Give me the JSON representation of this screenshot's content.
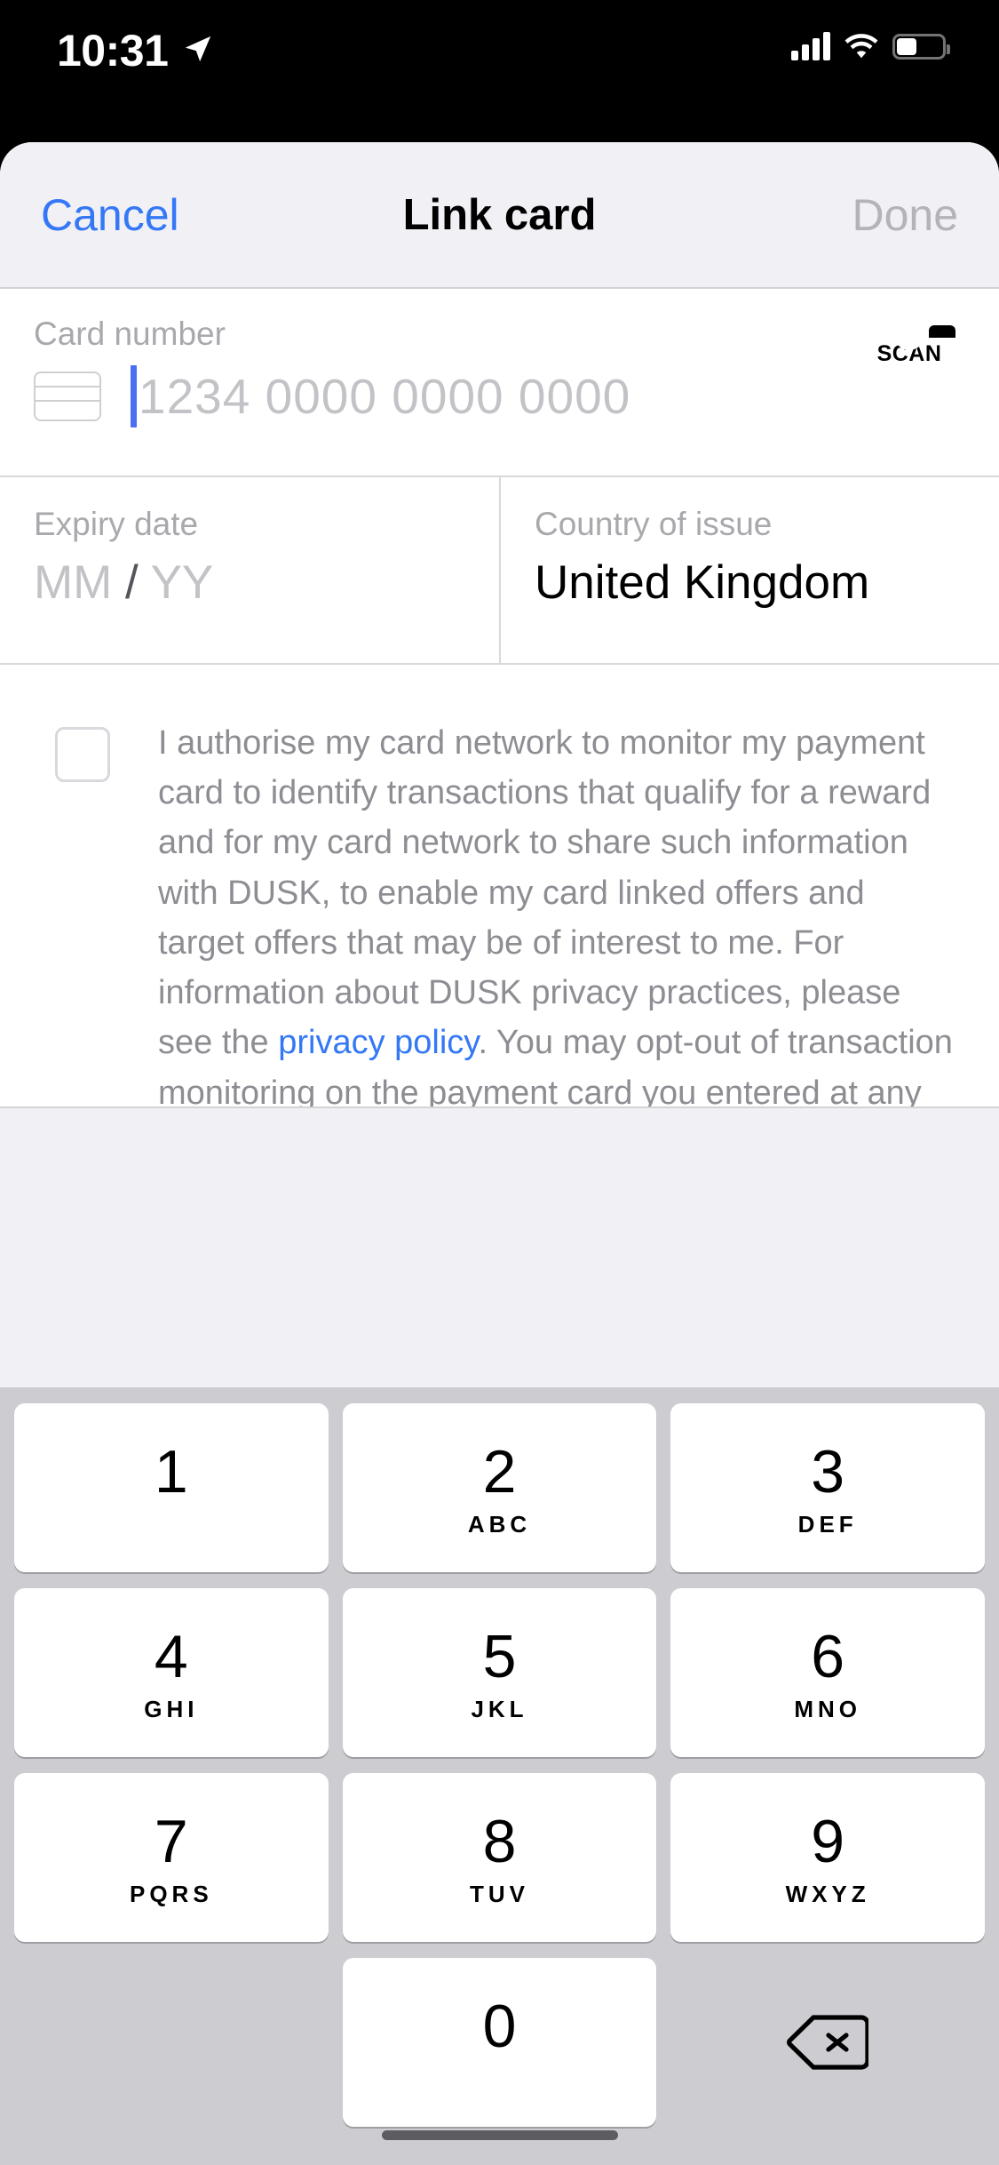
{
  "status_bar": {
    "time": "10:31",
    "icons": [
      "location-arrow-icon",
      "cellular-signal-icon",
      "wifi-icon",
      "battery-icon"
    ]
  },
  "navbar": {
    "cancel_label": "Cancel",
    "title": "Link card",
    "done_label": "Done",
    "cancel_color": "#3478f6",
    "done_color": "#b4b3b8"
  },
  "form": {
    "card_number": {
      "label": "Card number",
      "value": "",
      "placeholder": "1234 0000 0000 0000",
      "caret_color": "#4a6ff0",
      "scan_label": "SCAN"
    },
    "expiry": {
      "label": "Expiry date",
      "month_placeholder": "MM",
      "separator": "/",
      "year_placeholder": "YY"
    },
    "country": {
      "label": "Country of issue",
      "value": "United Kingdom"
    }
  },
  "consent": {
    "checked": false,
    "text_part_1": "I authorise my card network to monitor my payment card to identify transactions that qualify for a reward and for my card network to share such information with DUSK, to enable my card linked offers and target offers that may be of interest to me. For information about DUSK privacy practices, please see the ",
    "link_label": "privacy policy",
    "text_part_2": ". You may opt-out of transaction monitoring on the payment card you entered at any time by going to your account settings.",
    "link_color": "#3478f6"
  },
  "keyboard": {
    "type": "numeric-pad",
    "rows": [
      [
        {
          "digit": "1",
          "letters": ""
        },
        {
          "digit": "2",
          "letters": "ABC"
        },
        {
          "digit": "3",
          "letters": "DEF"
        }
      ],
      [
        {
          "digit": "4",
          "letters": "GHI"
        },
        {
          "digit": "5",
          "letters": "JKL"
        },
        {
          "digit": "6",
          "letters": "MNO"
        }
      ],
      [
        {
          "digit": "7",
          "letters": "PQRS"
        },
        {
          "digit": "8",
          "letters": "TUV"
        },
        {
          "digit": "9",
          "letters": "WXYZ"
        }
      ],
      [
        {
          "digit": "",
          "letters": ""
        },
        {
          "digit": "0",
          "letters": ""
        },
        {
          "digit": "delete-icon",
          "letters": ""
        }
      ]
    ]
  }
}
